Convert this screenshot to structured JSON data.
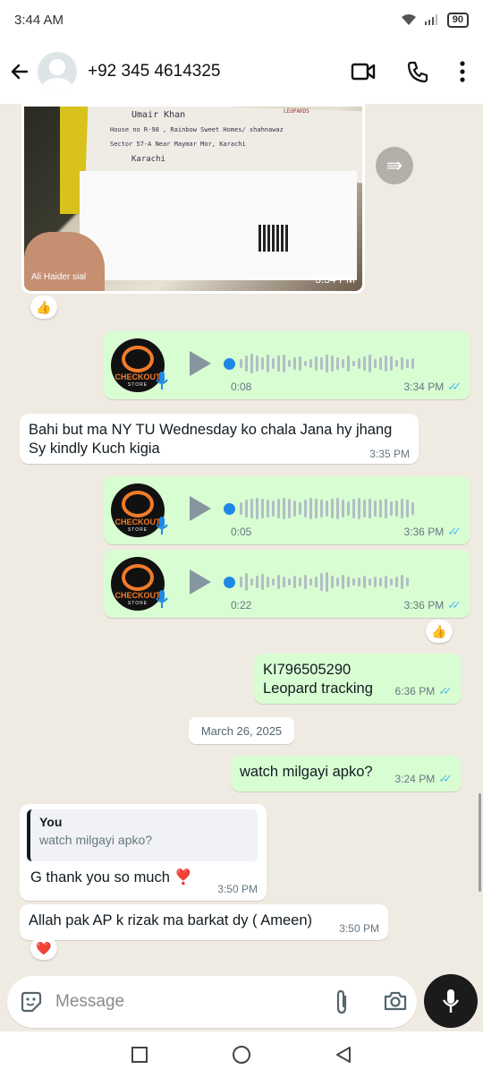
{
  "status": {
    "time": "3:44 AM",
    "battery": "90"
  },
  "header": {
    "contact": "+92 345 4614325"
  },
  "image_message": {
    "caption": "Ali Haider sial",
    "time": "3:34 PM",
    "reaction": "👍",
    "photo_text": {
      "name": "Umair Khan",
      "address": "House no R-98 , Rainbow Sweet Homes/ shahnawaz",
      "sector": "Sector 57-A Near Maymar Mor, Karachi",
      "city": "Karachi",
      "label": "LEOPARDS"
    }
  },
  "voice_notes": [
    {
      "duration": "0:08",
      "time": "3:34 PM",
      "progress": 0
    },
    {
      "duration": "0:05",
      "time": "3:36 PM",
      "progress": 0
    },
    {
      "duration": "0:22",
      "time": "3:36 PM",
      "progress": 0
    }
  ],
  "voice_brand": {
    "name": "CHECKOUT",
    "sub": "STORE"
  },
  "voice_reaction": "👍",
  "messages": {
    "incoming_1": {
      "text": "Bahi but ma NY TU Wednesday ko chala Jana hy jhang Sy kindly Kuch kigia",
      "time": "3:35 PM"
    },
    "outgoing_tracking": {
      "line1": "KI796505290",
      "line2": "Leopard tracking",
      "time": "6:36 PM"
    },
    "date_chip": "March 26, 2025",
    "outgoing_2": {
      "text": "watch milgayi apko?",
      "time": "3:24 PM"
    },
    "reply": {
      "quote_author": "You",
      "quote_text": "watch milgayi apko?",
      "text": "G thank you so much",
      "emoji": "❣️",
      "time": "3:50 PM"
    },
    "incoming_last": {
      "text": "Allah pak AP k rizak ma barkat dy ( Ameen)",
      "time": "3:50 PM",
      "reaction": "❤️"
    }
  },
  "input": {
    "placeholder": "Message"
  }
}
